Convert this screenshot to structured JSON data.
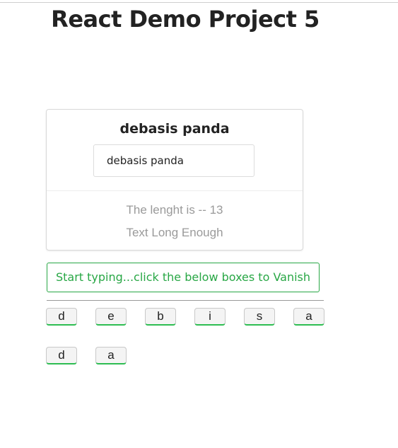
{
  "header": {
    "title": "React Demo Project 5"
  },
  "card": {
    "name_display": "debasis panda",
    "input_value": "debasis panda",
    "length_text": "The lenght is -- 13",
    "status_text": "Text Long Enough"
  },
  "hint": {
    "text": "Start typing...click the below boxes to Vanish"
  },
  "chars": [
    "d",
    "e",
    "b",
    "i",
    "s",
    "a",
    "d",
    "a"
  ],
  "colors": {
    "accent_green": "#28a745",
    "muted_text": "#9a9a9a"
  }
}
